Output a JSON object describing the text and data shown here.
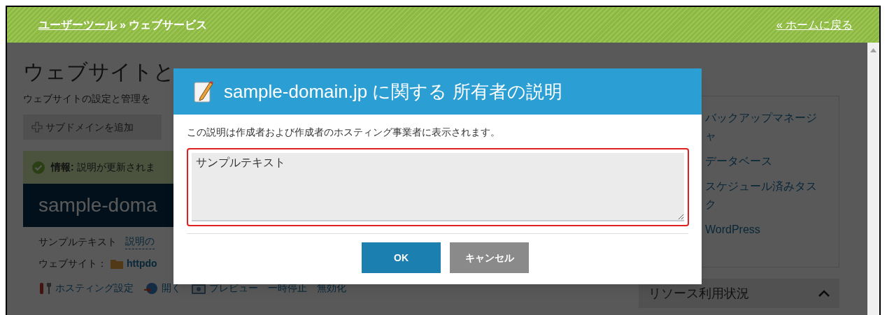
{
  "header": {
    "breadcrumb_link": "ユーザーツール",
    "separator": "»",
    "current": "ウェブサービス",
    "home_link": "« ホームに戻る"
  },
  "page": {
    "title": "ウェブサイトと",
    "subtitle": "ウェブサイトの設定と管理を",
    "add_button": "サブドメインを追加",
    "info": "**情報:** 説明が更新されま",
    "domain": "sample-doma",
    "description": "サンプルテキスト",
    "description_link": "説明の",
    "website_label": "ウェブサイト：",
    "website_link": "httpdo",
    "actions": [
      "ホスティング設定",
      "開く",
      "プレビュー",
      "一時停止",
      "無効化"
    ]
  },
  "sidebar": {
    "links": [
      "バックアップマネージャ",
      "データベース",
      "スケジュール済みタスク",
      "WordPress"
    ],
    "resource_panel": {
      "title": "リソース利用状況",
      "expanded": true
    }
  },
  "dialog": {
    "title": "sample-domain.jp に関する 所有者の説明",
    "message": "この説明は作成者および作成者のホスティング事業者に表示されます。",
    "value": "サンプルテキスト",
    "buttons": [
      {
        "label": "OK",
        "kind": "primary"
      },
      {
        "label": "キャンセル",
        "kind": "secondary"
      }
    ]
  }
}
